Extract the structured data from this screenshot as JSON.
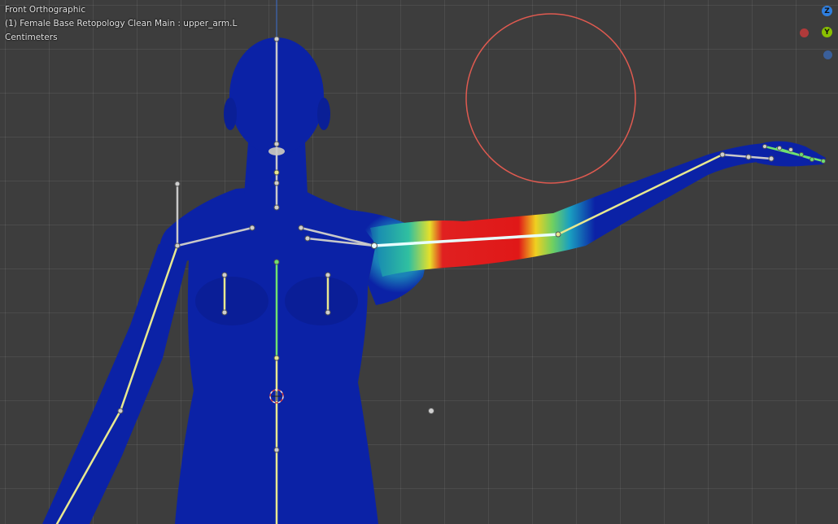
{
  "viewport": {
    "view_name": "Front Orthographic",
    "object_info": "(1) Female Base Retopology Clean Main : upper_arm.L",
    "units": "Centimeters"
  },
  "gizmo": {
    "z_label": "Z",
    "y_label": "Y",
    "z_color": "#2f7fe0",
    "y_color": "#8ac000",
    "x_color": "#b03a3a",
    "neg_y_color": "#3a5f9a"
  },
  "colors": {
    "grid_bg": "#3d3d3d",
    "mesh_blue": "#0b22a6",
    "weight_red": "#e01818",
    "weight_yellow": "#f0d020",
    "weight_green": "#2ec070",
    "bone_gray": "#c9c9c9",
    "bone_yellow": "#e8e890",
    "bone_green": "#6fe06f",
    "brush_circle": "#e05a50"
  },
  "icons": [
    "brush-circle-icon",
    "3d-cursor-icon",
    "bone-joint-icon"
  ]
}
